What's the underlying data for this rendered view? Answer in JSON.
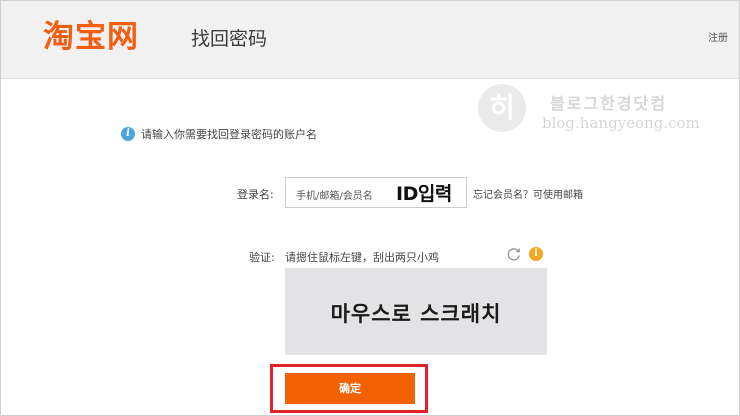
{
  "header": {
    "logo_text": "淘宝网",
    "title": "找回密码",
    "register_link": "注册"
  },
  "watermark": {
    "mark": "히",
    "line1": "블로그한경닷컴",
    "line2": "blog.hangyeong.com"
  },
  "form": {
    "hint": "请输入你需要找回登录密码的账户名",
    "username_label": "登录名:",
    "username_placeholder": "手机/邮箱/会员名",
    "username_overlay": "ID입력",
    "forgot_link": "忘记会员名？可使用邮箱",
    "verify_label": "验证:",
    "verify_instruction": "请摁住鼠标左键，刮出两只小鸡",
    "scratch_overlay": "마우스로 스크래치",
    "confirm_button": "确定"
  },
  "icons": {
    "info": "info-icon",
    "refresh": "refresh-icon",
    "warning": "info-warning-icon"
  },
  "colors": {
    "brand": "#f25e12",
    "button": "#f26205",
    "highlight": "#e0242a",
    "info": "#4fa3dc",
    "warning": "#f5a623"
  }
}
